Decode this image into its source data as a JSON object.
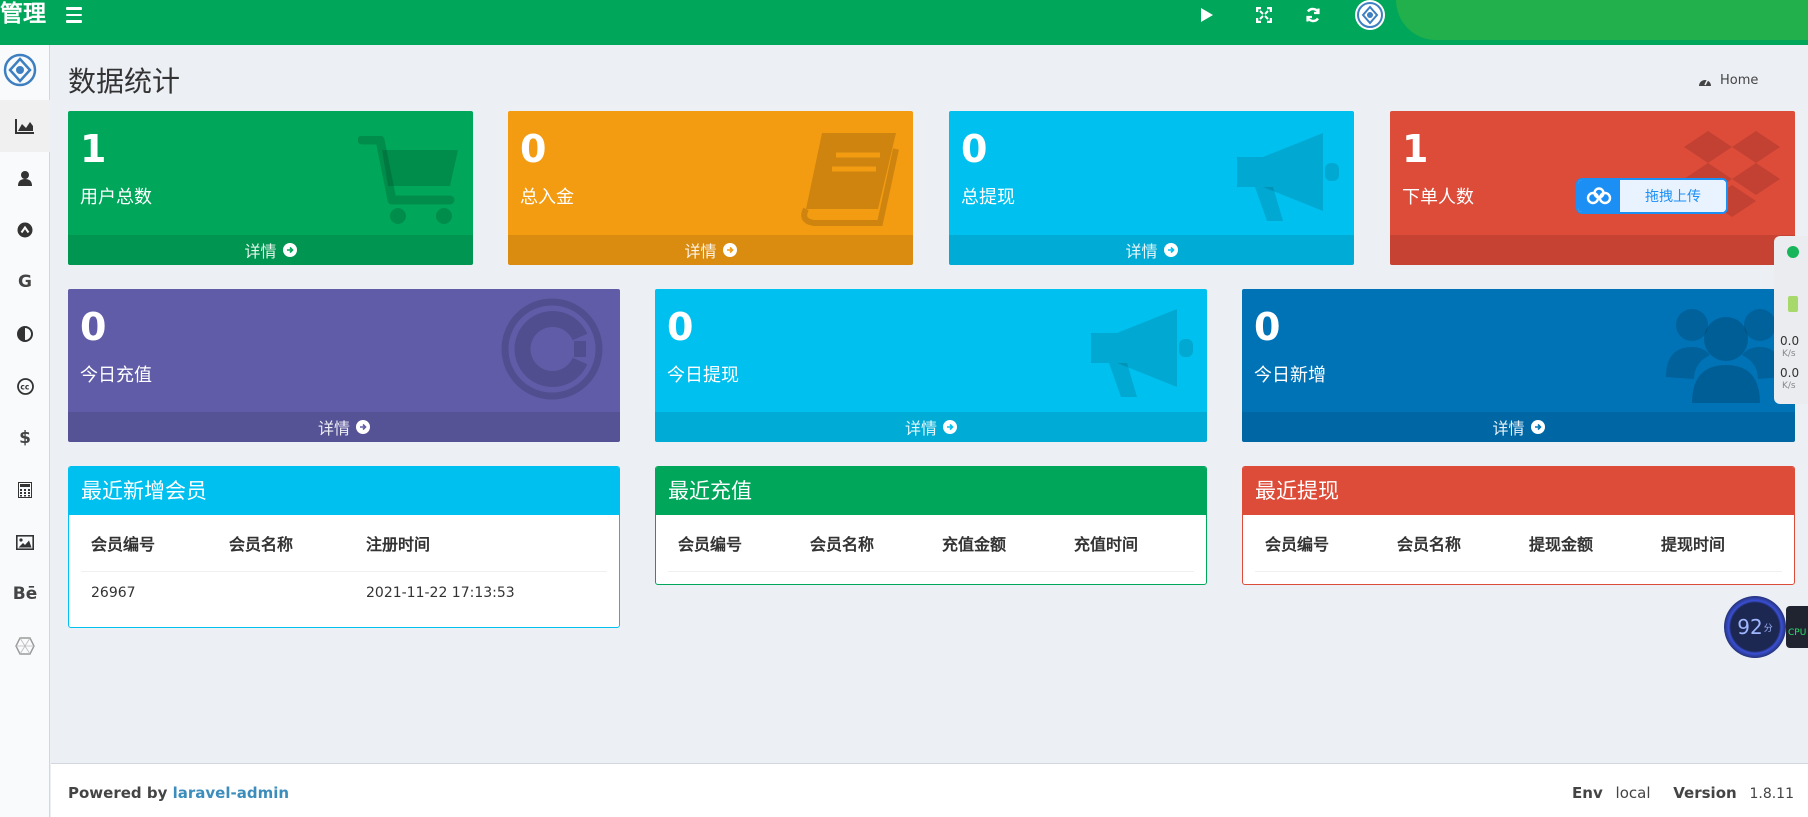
{
  "brand": "管理",
  "page_title": "数据统计",
  "breadcrumb": "Home",
  "boxes_row1": [
    {
      "value": "1",
      "label": "用户总数",
      "link": "详情",
      "color": "#00a65a"
    },
    {
      "value": "0",
      "label": "总入金",
      "link": "详情",
      "color": "#f39c12"
    },
    {
      "value": "0",
      "label": "总提现",
      "link": "详情",
      "color": "#00c0ef"
    },
    {
      "value": "1",
      "label": "下单人数",
      "link": "",
      "color": "#dd4b39"
    }
  ],
  "boxes_row2": [
    {
      "value": "0",
      "label": "今日充值",
      "link": "详情",
      "color": "#605ca8"
    },
    {
      "value": "0",
      "label": "今日提现",
      "link": "详情",
      "color": "#00c0ef"
    },
    {
      "value": "0",
      "label": "今日新增",
      "link": "详情",
      "color": "#0073b7"
    }
  ],
  "upload_label": "拖拽上传",
  "panels": {
    "members": {
      "title": "最近新增会员",
      "color": "#00c0ef",
      "columns": [
        "会员编号",
        "会员名称",
        "注册时间"
      ],
      "rows": [
        [
          "26967",
          "",
          "2021-11-22 17:13:53"
        ]
      ]
    },
    "recharge": {
      "title": "最近充值",
      "color": "#00a65a",
      "columns": [
        "会员编号",
        "会员名称",
        "充值金额",
        "充值时间"
      ]
    },
    "withdraw": {
      "title": "最近提现",
      "color": "#dd4b39",
      "columns": [
        "会员编号",
        "会员名称",
        "提现金额",
        "提现时间"
      ]
    }
  },
  "sidebar_icons": [
    "area-chart-icon",
    "user-icon",
    "chevron-up-circle-icon",
    "google-icon",
    "adjust-icon",
    "cc-icon",
    "dollar-icon",
    "calculator-icon",
    "image-icon",
    "behance-icon",
    "hexagon-icon"
  ],
  "sidebar_texts": {
    "google": "G",
    "dollar": "$",
    "behance": "Bē"
  },
  "footer": {
    "powered_by": "Powered by",
    "link": "laravel-admin",
    "env_label": "Env",
    "env_value": "local",
    "version_label": "Version",
    "version_value": "1.8.11"
  },
  "widget": {
    "up": "0.0",
    "up_unit": "K/s",
    "down": "0.0",
    "down_unit": "K/s",
    "score": "92",
    "score_unit": "分",
    "cpu": "CPU"
  }
}
